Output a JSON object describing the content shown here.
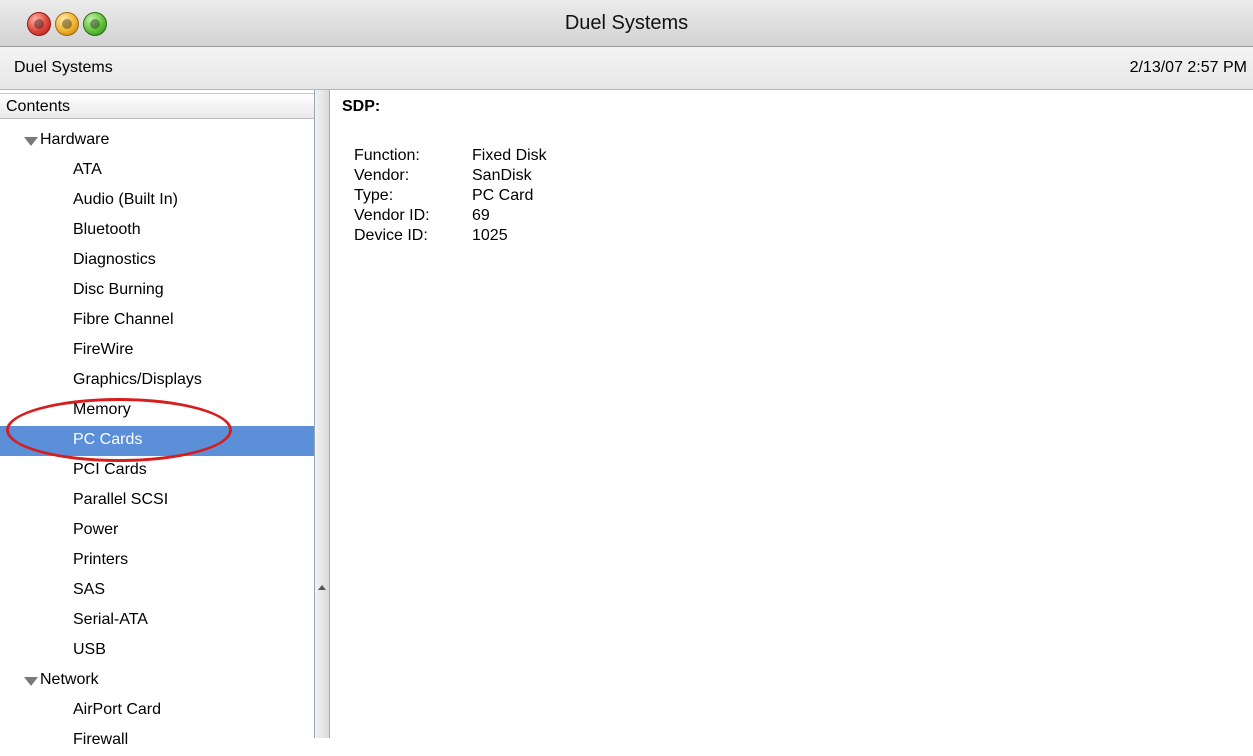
{
  "window": {
    "title": "Duel Systems"
  },
  "infobar": {
    "left": "Duel Systems",
    "right": "2/13/07 2:57 PM"
  },
  "sidebar": {
    "header": "Contents",
    "tree": [
      {
        "type": "group",
        "label": "Hardware"
      },
      {
        "type": "item",
        "label": "ATA"
      },
      {
        "type": "item",
        "label": "Audio (Built In)"
      },
      {
        "type": "item",
        "label": "Bluetooth"
      },
      {
        "type": "item",
        "label": "Diagnostics"
      },
      {
        "type": "item",
        "label": "Disc Burning"
      },
      {
        "type": "item",
        "label": "Fibre Channel"
      },
      {
        "type": "item",
        "label": "FireWire"
      },
      {
        "type": "item",
        "label": "Graphics/Displays"
      },
      {
        "type": "item",
        "label": "Memory"
      },
      {
        "type": "item",
        "label": "PC Cards",
        "selected": true
      },
      {
        "type": "item",
        "label": "PCI Cards"
      },
      {
        "type": "item",
        "label": "Parallel SCSI"
      },
      {
        "type": "item",
        "label": "Power"
      },
      {
        "type": "item",
        "label": "Printers"
      },
      {
        "type": "item",
        "label": "SAS"
      },
      {
        "type": "item",
        "label": "Serial-ATA"
      },
      {
        "type": "item",
        "label": "USB"
      },
      {
        "type": "group",
        "label": "Network"
      },
      {
        "type": "item",
        "label": "AirPort Card"
      },
      {
        "type": "item",
        "label": "Firewall"
      }
    ]
  },
  "content": {
    "title": "SDP:",
    "properties": [
      {
        "key": "Function:",
        "value": "Fixed Disk"
      },
      {
        "key": "Vendor:",
        "value": "SanDisk"
      },
      {
        "key": "Type:",
        "value": "PC Card"
      },
      {
        "key": "Vendor ID:",
        "value": "69"
      },
      {
        "key": "Device ID:",
        "value": "1025"
      }
    ]
  },
  "colors": {
    "selection": "#5b8fd8",
    "annotation": "#d71d1d"
  }
}
